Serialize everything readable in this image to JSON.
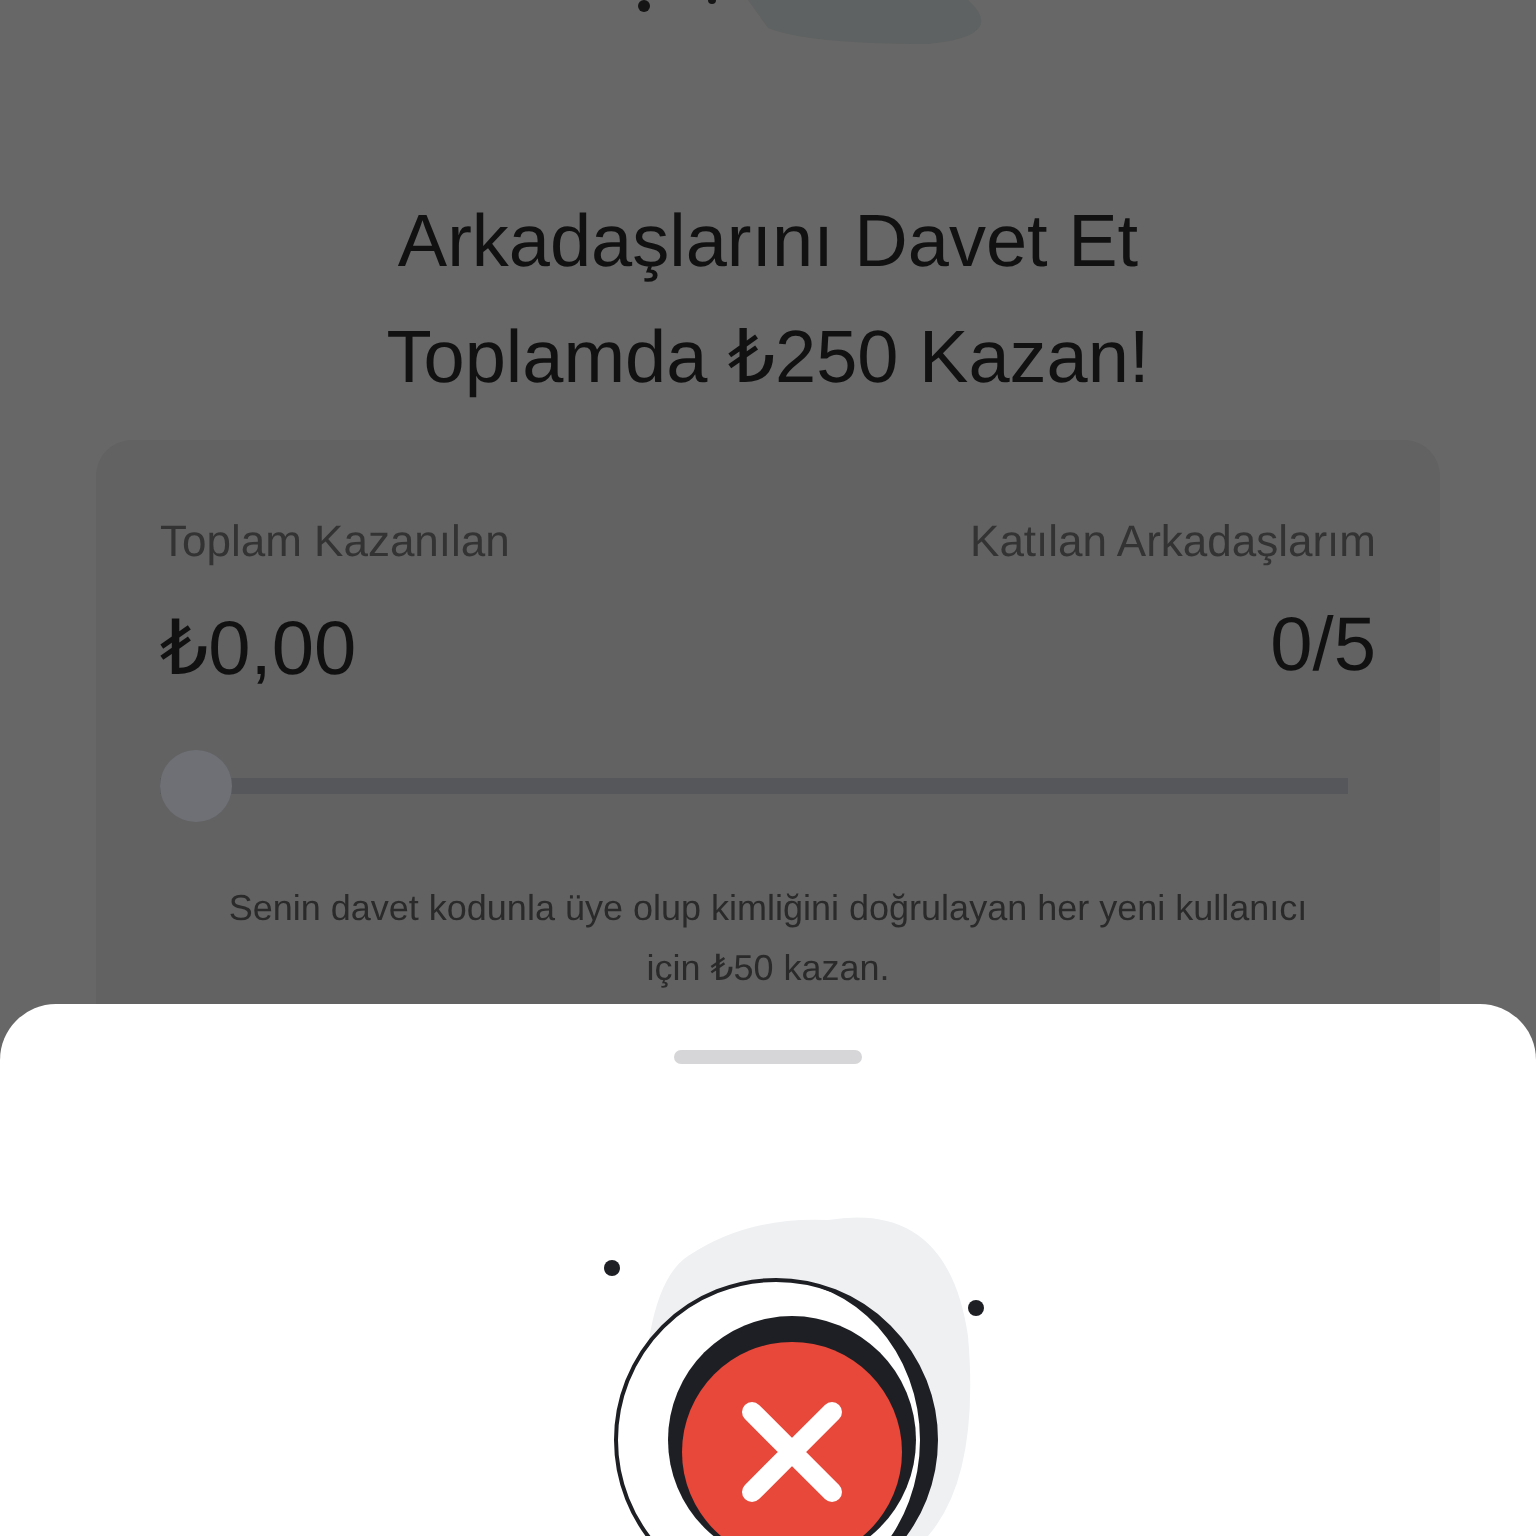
{
  "title_lines": [
    "Arkadaşlarını Davet Et",
    "Toplamda ₺250 Kazan!"
  ],
  "stats": [
    {
      "label": "Toplam Kazanılan",
      "value": "₺0,00"
    },
    {
      "label": "Katılan Arkadaşlarım",
      "value": "0/5"
    }
  ],
  "progress": {
    "level": 0
  },
  "note": "Senin davet kodunla üye olup kimliğini doğrulayan her yeni kullanıcı için ₺50 kazan."
}
